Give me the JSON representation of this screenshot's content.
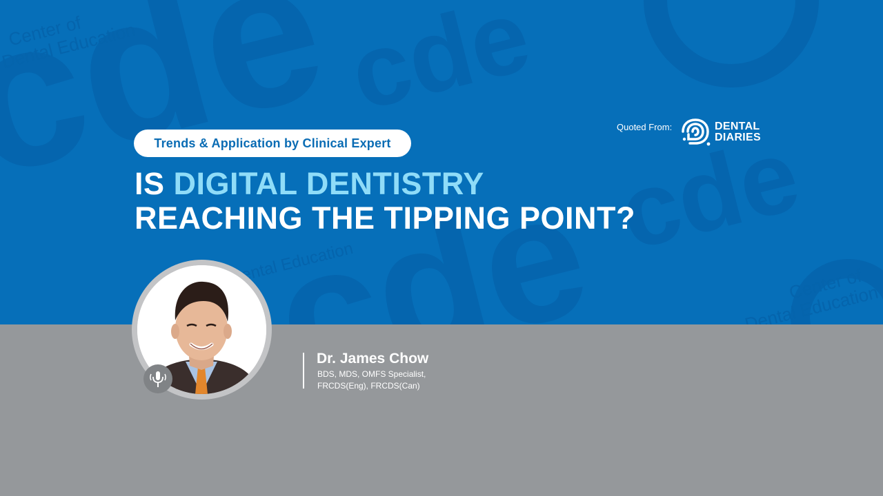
{
  "tagline": "Trends & Application by Clinical Expert",
  "headline": {
    "prefix": "IS ",
    "accent": "DIGITAL DENTISTRY",
    "line2": "REACHING THE TIPPING POINT?"
  },
  "quote_source": {
    "label": "Quoted From:",
    "brand_line1": "DENTAL",
    "brand_line2": "DIARIES"
  },
  "speaker": {
    "name": "Dr. James Chow",
    "credentials_line1": "BDS, MDS, OMFS Specialist,",
    "credentials_line2": "FRCDS(Eng), FRCDS(Can)"
  },
  "icons": {
    "brand_logo": "dental-diaries-logo-icon",
    "podcast": "microphone-icon"
  },
  "colors": {
    "primary_blue": "#066fb9",
    "accent_cyan": "#8fdcf8",
    "lower_gray": "#95989b"
  }
}
